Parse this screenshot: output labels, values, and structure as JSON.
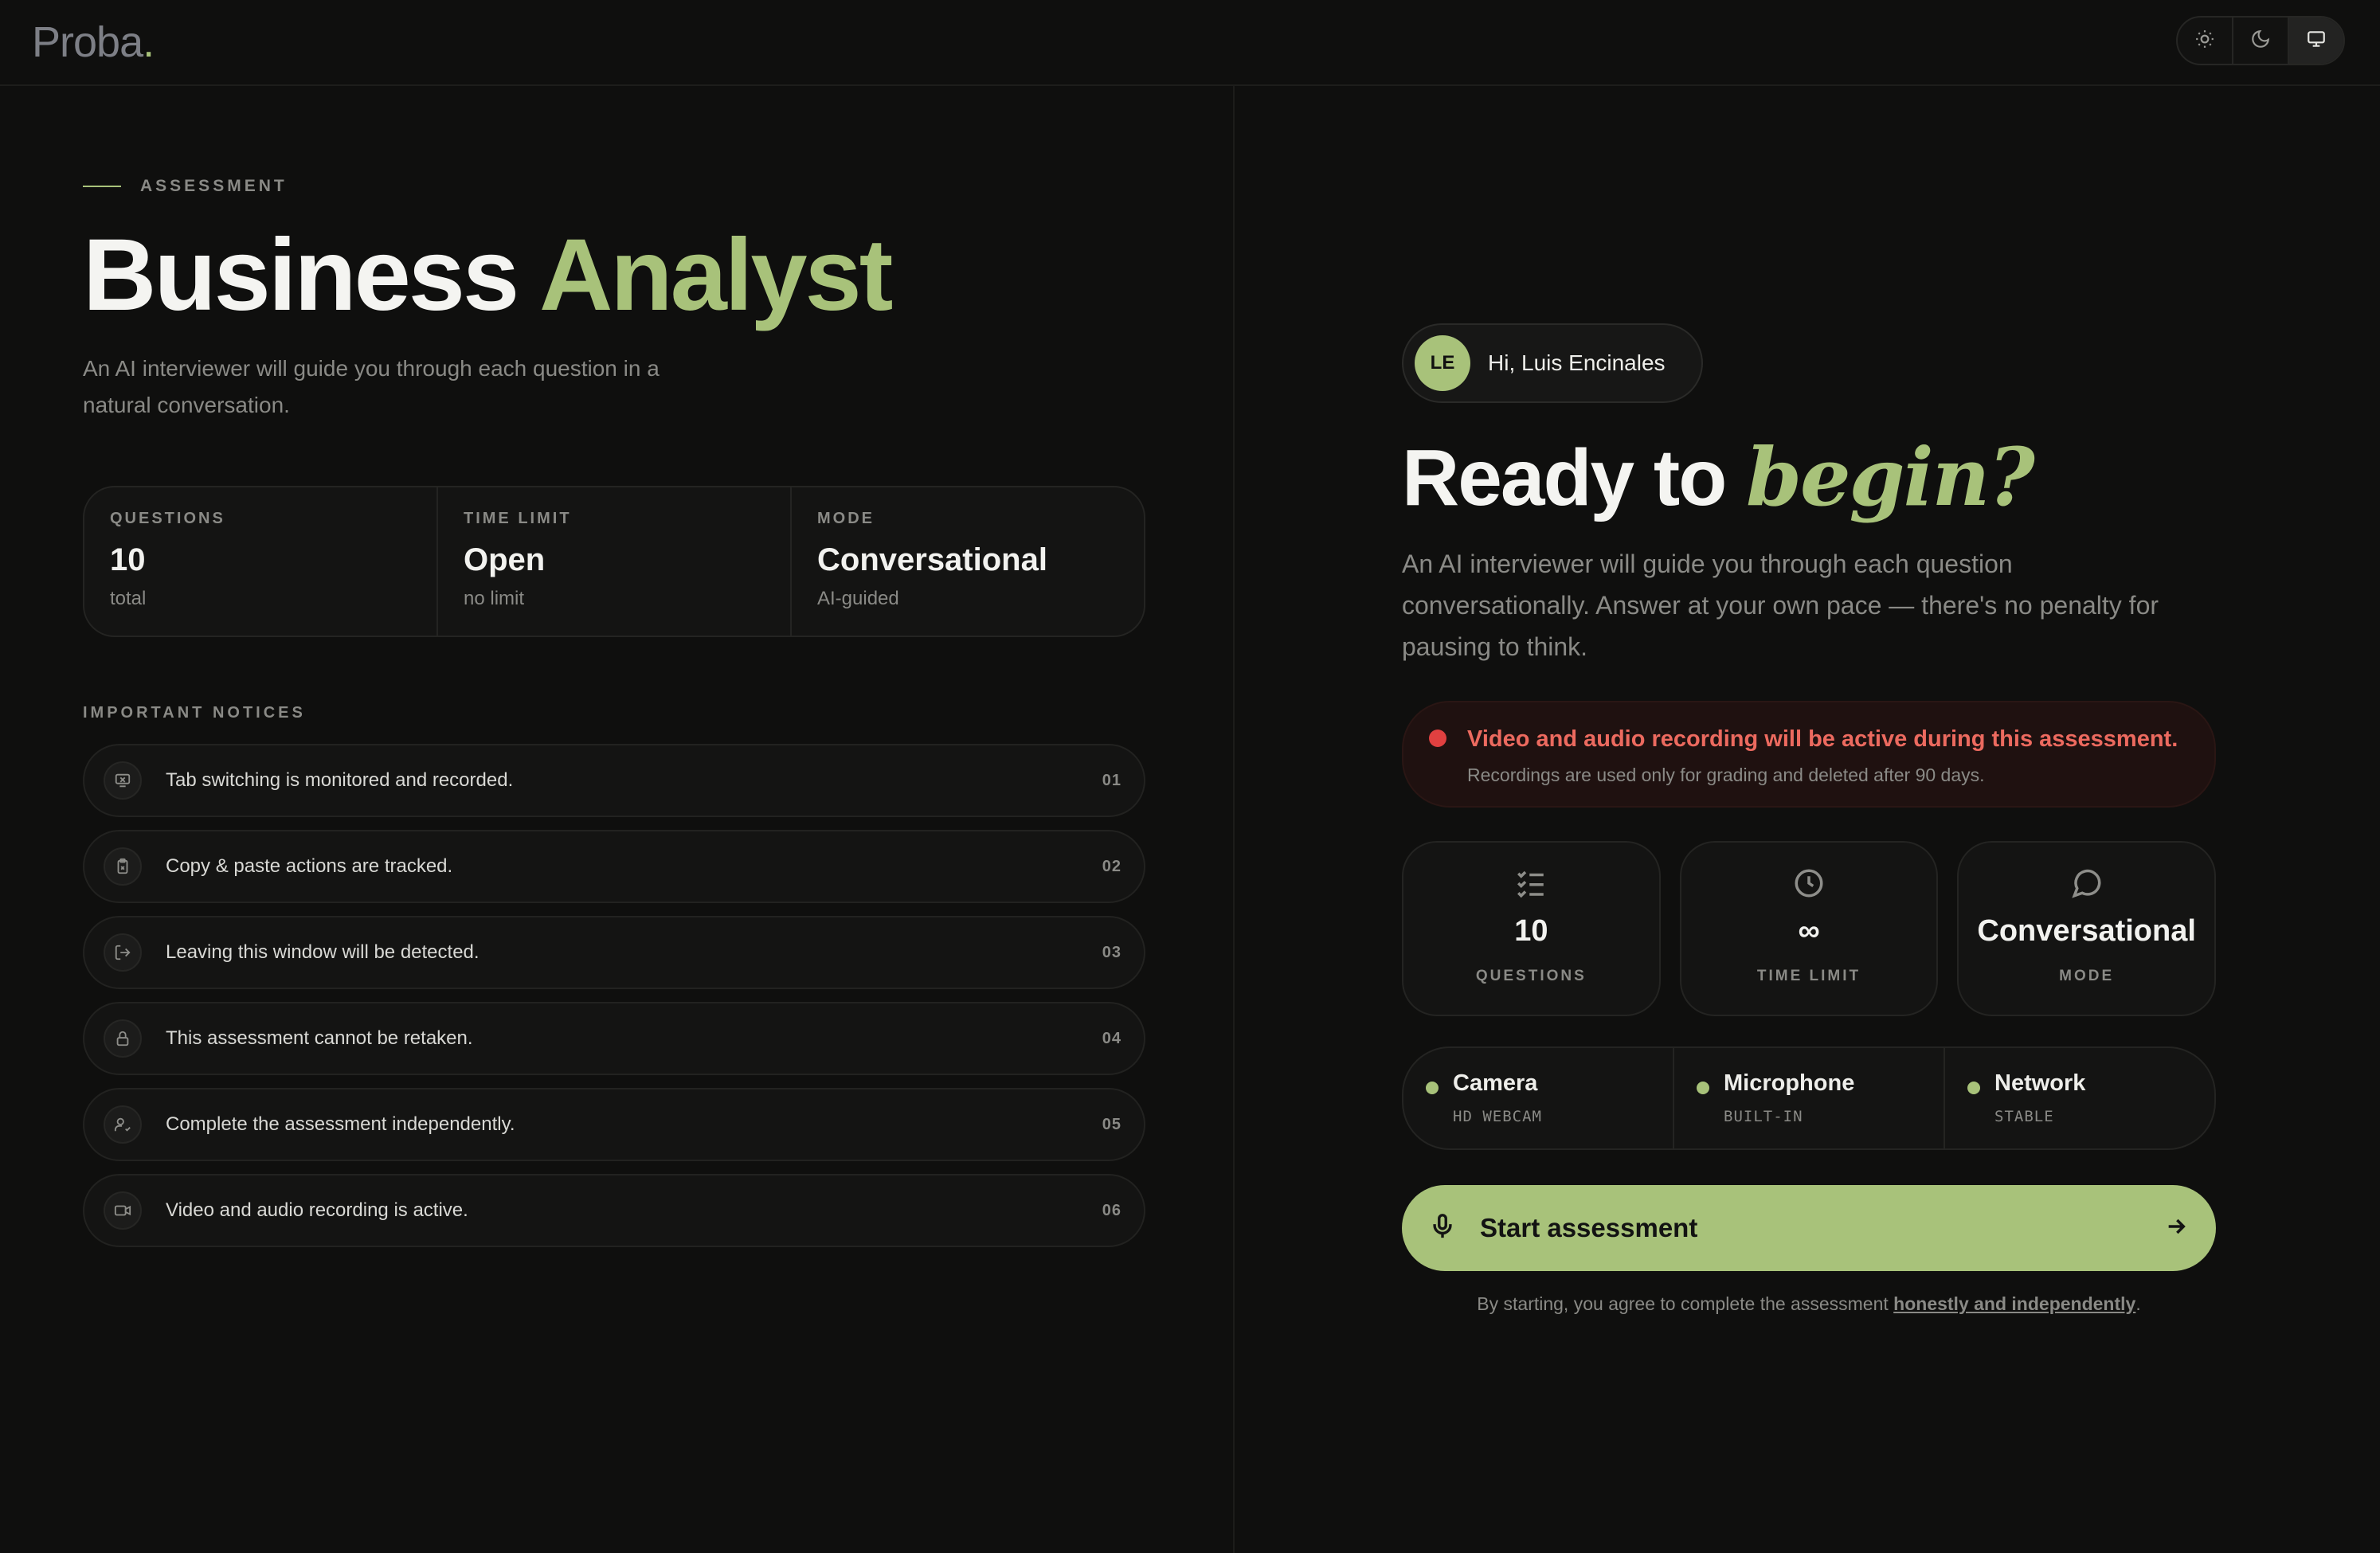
{
  "app": {
    "logo_text": "Proba",
    "logo_dot": ".",
    "brand_color": "#a8c27a",
    "theme_buttons": [
      {
        "icon": "sun-icon",
        "label": "Light"
      },
      {
        "icon": "moon-icon",
        "label": "Dark"
      },
      {
        "icon": "monitor-icon",
        "label": "System",
        "active": true
      }
    ]
  },
  "left": {
    "eyebrow": "ASSESSMENT",
    "title_main": "Business",
    "title_accent": "Analyst",
    "lead": "An AI interviewer will guide you through each question in a natural conversation.",
    "stats": [
      {
        "label": "QUESTIONS",
        "value": "10",
        "sub": "total"
      },
      {
        "label": "TIME LIMIT",
        "value": "Open",
        "sub": "no limit"
      },
      {
        "label": "MODE",
        "value": "Conversational",
        "sub": "AI-guided"
      }
    ],
    "notices_heading": "IMPORTANT NOTICES",
    "notices": [
      {
        "icon": "monitor-x-icon",
        "text": "Tab switching is monitored and recorded.",
        "num": "01"
      },
      {
        "icon": "clipboard-icon",
        "text": "Copy & paste actions are tracked.",
        "num": "02"
      },
      {
        "icon": "log-out-icon",
        "text": "Leaving this window will be detected.",
        "num": "03"
      },
      {
        "icon": "lock-icon",
        "text": "This assessment cannot be retaken.",
        "num": "04"
      },
      {
        "icon": "user-check-icon",
        "text": "Complete the assessment independently.",
        "num": "05"
      },
      {
        "icon": "video-icon",
        "text": "Video and audio recording is active.",
        "num": "06"
      }
    ]
  },
  "right": {
    "avatar_initials": "LE",
    "greeting": "Hi, Luis Encinales",
    "heading_main": "Ready to",
    "heading_accent": "begin?",
    "description": "An AI interviewer will guide you through each question conversationally. Answer at your own pace — there's no penalty for pausing to think.",
    "recording_alert": {
      "title": "Video and audio recording will be active during this assessment.",
      "subtitle": "Recordings are used only for grading and deleted after 90 days.",
      "color": "#ec6a5f"
    },
    "cards": [
      {
        "icon": "list-checks-icon",
        "value": "10",
        "label": "QUESTIONS"
      },
      {
        "icon": "clock-icon",
        "value": "∞",
        "label": "TIME LIMIT"
      },
      {
        "icon": "message-circle-icon",
        "value": "Conversational",
        "label": "MODE"
      }
    ],
    "devices": [
      {
        "name": "Camera",
        "sub": "HD WEBCAM",
        "status_color": "#a8c27a"
      },
      {
        "name": "Microphone",
        "sub": "BUILT-IN",
        "status_color": "#a8c27a"
      },
      {
        "name": "Network",
        "sub": "STABLE",
        "status_color": "#a8c27a"
      }
    ],
    "start_button": "Start assessment",
    "agree_prefix": "By starting, you agree to complete the assessment ",
    "agree_link": "honestly and independently",
    "agree_suffix": "."
  }
}
